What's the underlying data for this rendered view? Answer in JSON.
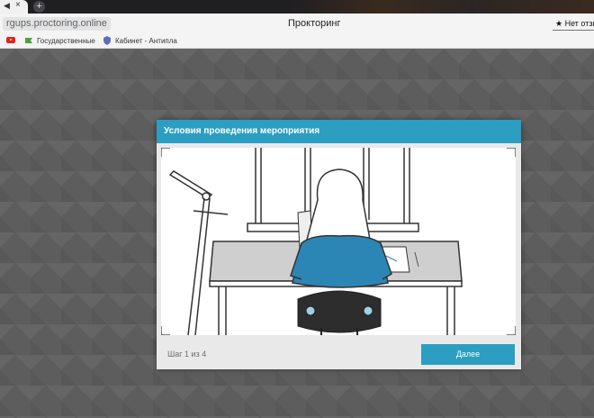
{
  "browser": {
    "tab_close": "×",
    "new_tab": "+",
    "url": "rgups.proctoring.online",
    "page_title": "Прокторинг",
    "feedback_label": "Нет отзыв",
    "bookmarks": [
      {
        "label": "Государственные",
        "icon": "flag-icon"
      },
      {
        "label": "Кабинет - Антипла",
        "icon": "shield-icon"
      }
    ]
  },
  "modal": {
    "title": "Условия проведения мероприятия",
    "step_label": "Шаг 1 из 4",
    "next_label": "Далее",
    "accent_color": "#2b9ec2"
  },
  "illustration": {
    "subject": "person-at-desk-illustration",
    "sweater_color": "#2c86b5",
    "chair_color": "#2d2d2d"
  }
}
